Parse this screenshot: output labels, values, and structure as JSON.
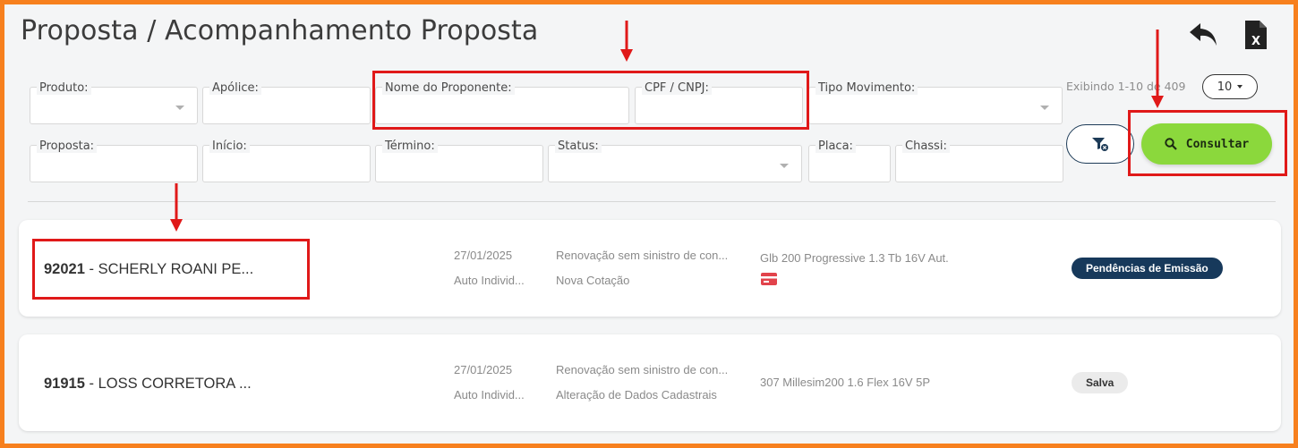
{
  "title": "Proposta / Acompanhamento Proposta",
  "toolbar": {
    "back_icon": "undo-arrow-icon",
    "export_icon": "excel-file-icon"
  },
  "filters": {
    "produto": "Produto:",
    "apolice": "Apólice:",
    "nome_proponente": "Nome do Proponente:",
    "cpf_cnpj": "CPF / CNPJ:",
    "tipo_movimento": "Tipo Movimento:",
    "proposta": "Proposta:",
    "inicio": "Início:",
    "termino": "Término:",
    "status": "Status:",
    "placa": "Placa:",
    "chassi": "Chassi:"
  },
  "pagination": {
    "showing": "Exibindo 1-10 de 409",
    "page_size": "10"
  },
  "actions": {
    "consultar": "Consultar",
    "clear_filter_icon": "filter-clear-icon"
  },
  "colors": {
    "frame": "#f7801e",
    "highlight": "#e01919",
    "consultar_bg": "#8bd83c",
    "badge_dark": "#17395b"
  },
  "results": [
    {
      "id": "92021",
      "name": "SCHERLY ROANI PE...",
      "date": "27/01/2025",
      "product": "Auto Individ...",
      "movement": "Renovação sem sinistro de con...",
      "type": "Nova Cotação",
      "vehicle": "Glb 200 Progressive 1.3 Tb 16V Aut.",
      "has_card_icon": true,
      "status": "Pendências de Emissão"
    },
    {
      "id": "91915",
      "name": "LOSS CORRETORA ...",
      "date": "27/01/2025",
      "product": "Auto Individ...",
      "movement": "Renovação sem sinistro de con...",
      "type": "Alteração de Dados Cadastrais",
      "vehicle": "307 Millesim200 1.6 Flex 16V 5P",
      "has_card_icon": false,
      "status": "Salva"
    }
  ]
}
